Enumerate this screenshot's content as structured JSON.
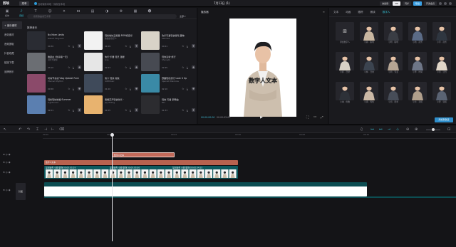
{
  "titlebar": {
    "app_name": "剪映",
    "menu_label": "菜单",
    "saved_text": "自动保存本地 · 保存至本地",
    "project_title": "7月13日 (1)",
    "shortcut_label": "快捷键",
    "vip_label": "VIP",
    "sync_label": "同步",
    "export_label": "导出",
    "membership_label": "开通会员"
  },
  "toolbar": {
    "items": [
      {
        "label": "媒体",
        "glyph": "▣"
      },
      {
        "label": "音频",
        "glyph": "♪"
      },
      {
        "label": "文本",
        "glyph": "T"
      },
      {
        "label": "贴纸",
        "glyph": "☺"
      },
      {
        "label": "特效",
        "glyph": "✦"
      },
      {
        "label": "转场",
        "glyph": "⋈"
      },
      {
        "label": "字幕",
        "glyph": "▤"
      },
      {
        "label": "滤镜",
        "glyph": "◑"
      },
      {
        "label": "调节",
        "glyph": "⚙"
      },
      {
        "label": "模板",
        "glyph": "▦"
      },
      {
        "label": "AI 数字人",
        "glyph": "☻"
      }
    ]
  },
  "sidebar": {
    "items": [
      {
        "label": "+ 音乐素材"
      },
      {
        "label": "音效素材"
      },
      {
        "label": "音频提取"
      },
      {
        "label": "抖音收藏"
      },
      {
        "label": "链接下载"
      },
      {
        "label": "品牌音乐"
      }
    ]
  },
  "search": {
    "placeholder": "搜索歌曲或艺术家",
    "sort_label": "全部"
  },
  "music": {
    "section_label": "推荐音乐",
    "tracks": [
      {
        "title": "No More Limits",
        "artist": "Robert Ferguson",
        "duration": "00:30"
      },
      {
        "title": "轻松愉快正能量 BGM纯音乐",
        "artist": "愉悦的音乐人",
        "duration": "01:09"
      },
      {
        "title": "欢乐可爱轻快游戏 趣味",
        "artist": "Kalimba",
        "duration": "00:41"
      },
      {
        "title": "晚星在 (伴奏唱一天)",
        "artist": "流行乐歌手",
        "duration": "03:10"
      },
      {
        "title": "快乐·乐器 轻灵 温暖",
        "artist": "Lisa",
        "duration": "02:23"
      },
      {
        "title": "轻快清新·旅行",
        "artist": "Shenglin",
        "duration": "02:45"
      },
      {
        "title": "时尚节奏感·Vlog Upbeat Funk",
        "artist": "Eternal Rhythm",
        "duration": "00:58"
      },
      {
        "title": "简介 轻快 愉悦",
        "artist": "SoftMusic",
        "duration": "01:20"
      },
      {
        "title": "野趣轻松旅行 Look it Up",
        "artist": "Spanish Rainbow",
        "duration": "02:10"
      },
      {
        "title": "轻松轻快愉悦·Summer",
        "artist": "Lightmusic",
        "duration": "02:01"
      },
      {
        "title": "春暖花开轻快欢乐 ·",
        "artist": "Jay Zhang",
        "duration": "01:05"
      },
      {
        "title": "轻快 可爱 钢琴曲",
        "artist": "Miu",
        "duration": "01:33"
      }
    ]
  },
  "player": {
    "title": "播放器",
    "overlay_text": "数字人文本",
    "time_current": "00:00:00:00",
    "time_total": "00:00:05:00"
  },
  "right_panel": {
    "tabs": [
      {
        "label": "文本"
      },
      {
        "label": "动画"
      },
      {
        "label": "跟踪"
      },
      {
        "label": "朗读"
      },
      {
        "label": "数字人"
      }
    ],
    "add_label": "添加数字人",
    "avatars": [
      {
        "name": "小静 · 职场"
      },
      {
        "name": "小明 · 职场"
      },
      {
        "name": "小航 · 商务"
      },
      {
        "name": "小宇 · 商务"
      },
      {
        "name": "小婷 · 日常"
      },
      {
        "name": "小林 · 日常"
      },
      {
        "name": "小鸣 · 专业"
      },
      {
        "name": "小泽 · 时尚"
      },
      {
        "name": "小月 · 活力"
      },
      {
        "name": "小琳 · 优雅"
      },
      {
        "name": "小涵 · 知性"
      },
      {
        "name": "小凯 · 稳重"
      },
      {
        "name": "小言 · 亲和"
      },
      {
        "name": "小安 · 温和"
      }
    ],
    "add_to_track_label": "添加到轨道"
  },
  "timeline": {
    "ruler_ticks": [
      "00:00",
      "00:02",
      "00:04",
      "00:06",
      "00:08",
      "00:10"
    ],
    "text_clip_label": "数字人文本",
    "digital_human_clip_label": "数字人文本",
    "segment_labels": [
      "复刻音色  小静  职场  00:00:05:29",
      "复刻音色  小静  职场  00:00:05:00",
      "复刻音色  小静  职场  00:00:04:15"
    ],
    "video_clip_label": "photooriginal.jpg  00:00:05:00",
    "cover_label": "封面"
  },
  "colors": {
    "accent": "#36c3d6",
    "text_clip": "#c26a5a",
    "digital_human_clip": "#b8624f",
    "video_track": "#0e5a5f",
    "main_track": "#0c4d52"
  }
}
